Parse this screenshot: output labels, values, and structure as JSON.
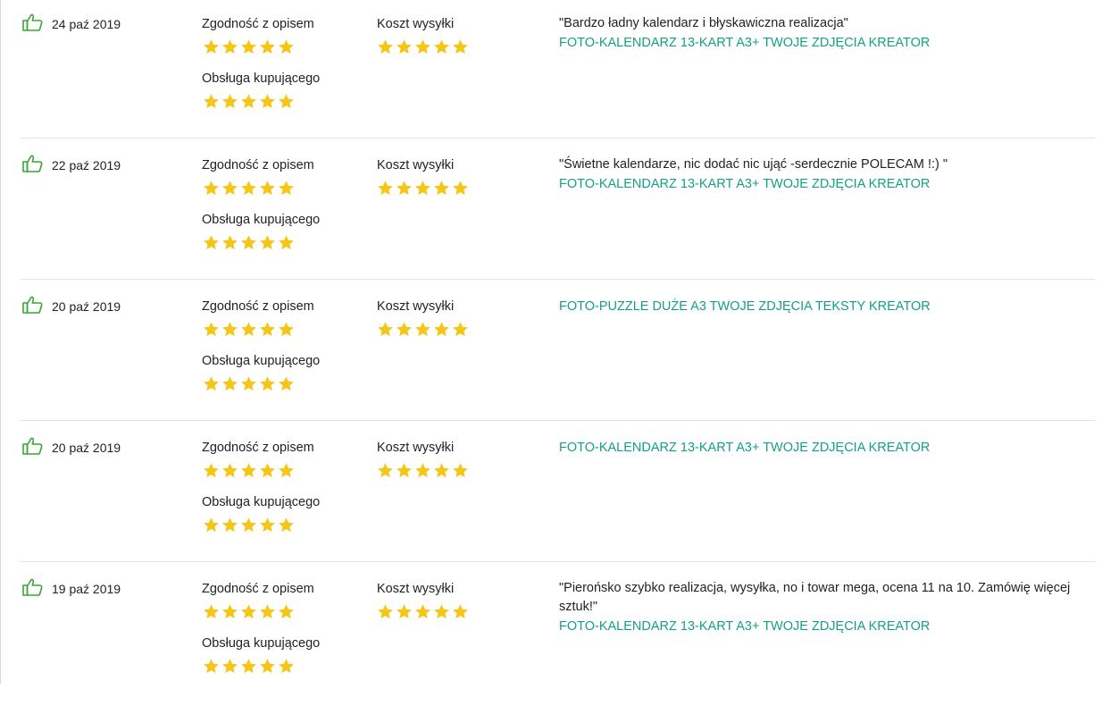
{
  "colors": {
    "star": "#f5c518",
    "thumb": "#3aa635",
    "product_link": "#14a085",
    "divider": "#e3e3e3"
  },
  "labels": {
    "accuracy": "Zgodność z opisem",
    "shipping": "Koszt wysyłki",
    "service": "Obsługa kupującego"
  },
  "reviews": [
    {
      "icon": "thumbs-up-icon",
      "date": "24 paź 2019",
      "ratings": {
        "accuracy": 5,
        "shipping": 5,
        "service": 5
      },
      "comment": "\"Bardzo ładny kalendarz i błyskawiczna realizacja\"",
      "product": "FOTO-KALENDARZ 13-KART A3+ TWOJE ZDJĘCIA KREATOR"
    },
    {
      "icon": "thumbs-up-icon",
      "date": "22 paź 2019",
      "ratings": {
        "accuracy": 5,
        "shipping": 5,
        "service": 5
      },
      "comment": "\"Świetne kalendarze, nic dodać nic ująć -serdecznie POLECAM !:) \"",
      "product": "FOTO-KALENDARZ 13-KART A3+ TWOJE ZDJĘCIA KREATOR"
    },
    {
      "icon": "thumbs-up-icon",
      "date": "20 paź 2019",
      "ratings": {
        "accuracy": 5,
        "shipping": 5,
        "service": 5
      },
      "comment": "",
      "product": "FOTO-PUZZLE DUŻE A3 TWOJE ZDJĘCIA TEKSTY KREATOR"
    },
    {
      "icon": "thumbs-up-icon",
      "date": "20 paź 2019",
      "ratings": {
        "accuracy": 5,
        "shipping": 5,
        "service": 5
      },
      "comment": "",
      "product": "FOTO-KALENDARZ 13-KART A3+ TWOJE ZDJĘCIA KREATOR"
    },
    {
      "icon": "thumbs-up-icon",
      "date": "19 paź 2019",
      "ratings": {
        "accuracy": 5,
        "shipping": 5,
        "service": 5
      },
      "comment": "\"Pierońsko szybko realizacja, wysyłka, no i towar mega, ocena 11 na 10. Zamówię więcej sztuk!\"",
      "product": "FOTO-KALENDARZ 13-KART A3+ TWOJE ZDJĘCIA KREATOR"
    }
  ]
}
